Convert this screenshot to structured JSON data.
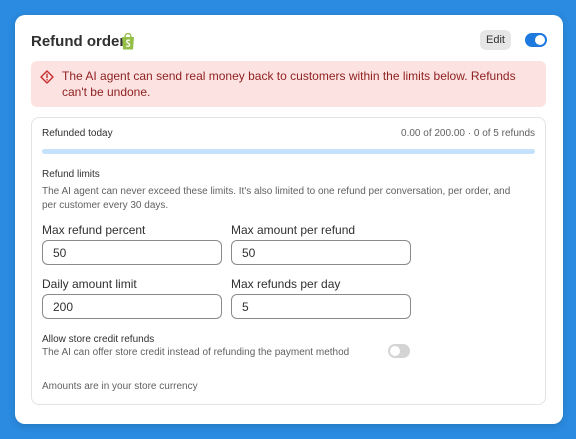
{
  "header": {
    "title": "Refund order",
    "app_icon": "shopify-bag-icon",
    "edit_label": "Edit",
    "enabled": true
  },
  "banner": {
    "icon": "alert-diamond-icon",
    "text": "The AI agent can send real money back to customers within the limits below. Refunds can't be undone."
  },
  "today": {
    "label": "Refunded today",
    "status": "0.00 of 200.00 · 0 of 5 refunds",
    "progress_fraction": 0
  },
  "limits": {
    "title": "Refund limits",
    "description": "The AI agent can never exceed these limits. It's also limited to one refund per conversation, per order, and per customer every 30 days.",
    "fields": [
      {
        "label": "Max refund percent",
        "value": "50"
      },
      {
        "label": "Max amount per refund",
        "value": "50"
      },
      {
        "label": "Daily amount limit",
        "value": "200"
      },
      {
        "label": "Max refunds per day",
        "value": "5"
      }
    ]
  },
  "store_credit": {
    "title": "Allow store credit refunds",
    "description": "The AI can offer store credit instead of refunding the payment method",
    "enabled": false
  },
  "footer_note": "Amounts are in your store currency",
  "colors": {
    "background": "#2b8be0",
    "accent": "#1f7ae0",
    "banner_bg": "#fde2e2",
    "banner_text": "#8e1f1f",
    "progress_track": "#c5e1fb"
  }
}
